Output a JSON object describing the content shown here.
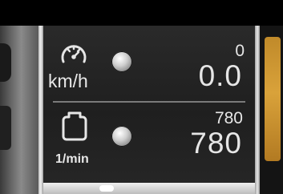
{
  "speed": {
    "icon": "speedometer-icon",
    "unit": "km/h",
    "limit_value": "0",
    "current_value": "0.0"
  },
  "engine": {
    "icon": "engine-icon",
    "unit": "1/min",
    "limit_value": "780",
    "current_value": "780"
  },
  "colors": {
    "panel_bg": "#232323",
    "text": "#e6e6e6",
    "lamp": "#cfcfcf",
    "amber_window": "#d09a35"
  }
}
